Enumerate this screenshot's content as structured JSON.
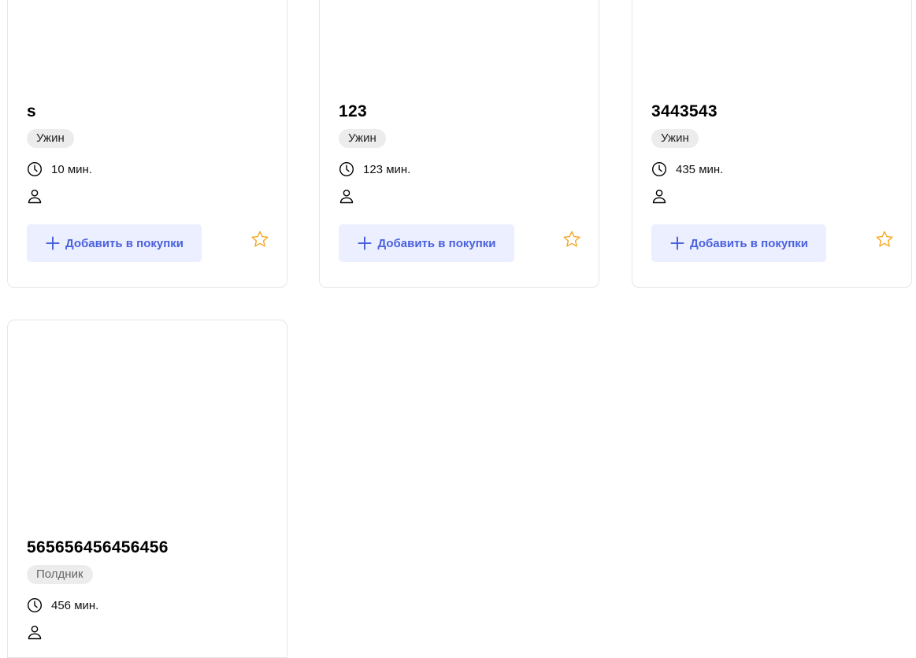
{
  "recipes": [
    {
      "title": "s",
      "tag": "Ужин",
      "time": "10 мин.",
      "add_label": "Добавить в покупки"
    },
    {
      "title": "123",
      "tag": "Ужин",
      "time": "123 мин.",
      "add_label": "Добавить в покупки"
    },
    {
      "title": "3443543",
      "tag": "Ужин",
      "time": "435 мин.",
      "add_label": "Добавить в покупки"
    },
    {
      "title": "565656456456456",
      "tag": "Полдник",
      "time": "456 мин."
    }
  ],
  "colors": {
    "accent": "#4a61dd",
    "button_bg": "#ecefff",
    "tag_bg": "#ececec",
    "star": "#f5a623",
    "card_border": "#e6e6e6"
  }
}
